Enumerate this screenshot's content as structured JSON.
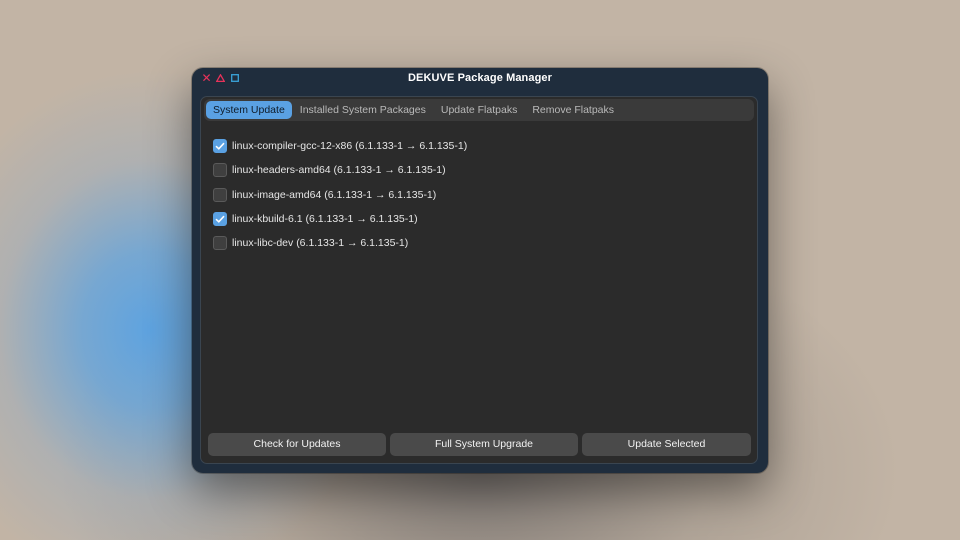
{
  "window": {
    "title": "DEKUVE Package Manager"
  },
  "titlebar_controls": [
    {
      "name": "close",
      "glyph": "✕",
      "icon": "close-icon",
      "color": "#e8325a"
    },
    {
      "name": "minimize",
      "icon": "triangle-icon",
      "color": "#e8325a"
    },
    {
      "name": "maximize",
      "icon": "square-icon",
      "color": "#3aa3d9"
    }
  ],
  "tabs": [
    {
      "label": "System Update",
      "active": true
    },
    {
      "label": "Installed System Packages",
      "active": false
    },
    {
      "label": "Update Flatpaks",
      "active": false
    },
    {
      "label": "Remove Flatpaks",
      "active": false
    }
  ],
  "packages": [
    {
      "label": "linux-compiler-gcc-12-x86 (6.1.133-1 → 6.1.135-1)",
      "checked": true
    },
    {
      "label": "linux-headers-amd64 (6.1.133-1 → 6.1.135-1)",
      "checked": false
    },
    {
      "label": "linux-image-amd64 (6.1.133-1 → 6.1.135-1)",
      "checked": false
    },
    {
      "label": "linux-kbuild-6.1 (6.1.133-1 → 6.1.135-1)",
      "checked": true
    },
    {
      "label": "linux-libc-dev (6.1.133-1 → 6.1.135-1)",
      "checked": false
    }
  ],
  "buttons": {
    "check": "Check for Updates",
    "full": "Full System Upgrade",
    "selected": "Update Selected"
  },
  "colors": {
    "accent": "#5aa1e3",
    "window_bg": "#1f2d3d",
    "panel_bg": "#2b2b2b"
  }
}
